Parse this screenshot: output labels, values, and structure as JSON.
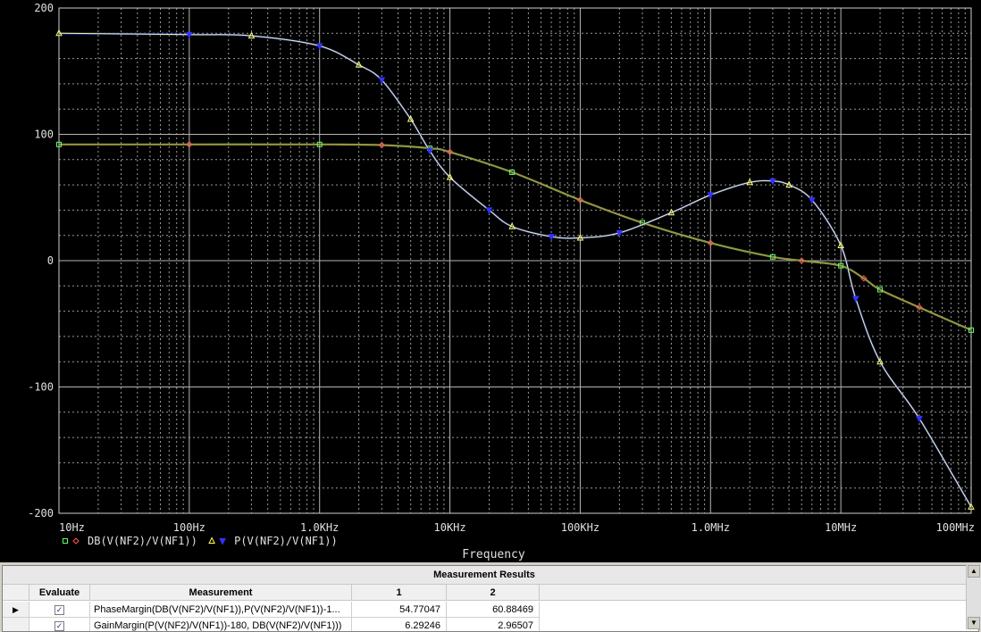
{
  "chart_data": {
    "type": "line",
    "xscale": "log",
    "xlim": [
      10,
      100000000
    ],
    "ylim": [
      -200,
      200
    ],
    "xticks": [
      {
        "label": "10Hz",
        "value": 10
      },
      {
        "label": "100Hz",
        "value": 100
      },
      {
        "label": "1.0KHz",
        "value": 1000
      },
      {
        "label": "10KHz",
        "value": 10000
      },
      {
        "label": "100KHz",
        "value": 100000
      },
      {
        "label": "1.0MHz",
        "value": 1000000
      },
      {
        "label": "10MHz",
        "value": 10000000
      },
      {
        "label": "100MHz",
        "value": 100000000
      }
    ],
    "yticks": [
      {
        "label": "200",
        "value": 200
      },
      {
        "label": "100",
        "value": 100
      },
      {
        "label": "0",
        "value": 0
      },
      {
        "label": "-100",
        "value": -100
      },
      {
        "label": "-200",
        "value": -200
      }
    ],
    "xlabel": "Frequency",
    "grid": true,
    "series": [
      {
        "name": "DB(V(NF2)/V(NF1))",
        "colors": [
          "#ff5a5a",
          "#2ecc2e"
        ],
        "markers": [
          [
            "square",
            "#66ff66"
          ],
          [
            "diamond",
            "#ff5a5a"
          ]
        ],
        "x": [
          10,
          100,
          1000,
          3000,
          7000,
          10000,
          30000,
          100000,
          300000,
          1000000,
          3000000,
          5000000,
          10000000,
          15000000,
          20000000,
          40000000,
          100000000
        ],
        "y": [
          92,
          92,
          92,
          91.5,
          89,
          86,
          70,
          48,
          30,
          14,
          3,
          0,
          -4,
          -14,
          -23,
          -37,
          -55
        ]
      },
      {
        "name": "P(V(NF2)/V(NF1))",
        "colors": [
          "#ffff66",
          "#2233dd"
        ],
        "markers": [
          [
            "triangle",
            "#ffff66"
          ],
          [
            "triangle-down",
            "#3333ff"
          ]
        ],
        "x": [
          10,
          100,
          300,
          1000,
          2000,
          3000,
          5000,
          7000,
          10000,
          20000,
          30000,
          60000,
          100000,
          200000,
          500000,
          1000000,
          2000000,
          3000000,
          4000000,
          6000000,
          10000000,
          13000000,
          20000000,
          40000000,
          100000000
        ],
        "y": [
          180,
          179,
          178,
          170,
          155,
          143,
          112,
          87,
          66,
          40,
          27,
          19,
          18,
          22,
          38,
          52,
          62,
          63,
          60,
          48,
          12,
          -30,
          -80,
          -125,
          -195
        ]
      }
    ]
  },
  "results": {
    "title": "Measurement Results",
    "headers": {
      "evaluate": "Evaluate",
      "measurement": "Measurement",
      "col1": "1",
      "col2": "2"
    },
    "rows": [
      {
        "selector": "▶",
        "checked": "✓",
        "measurement": "PhaseMargin(DB(V(NF2)/V(NF1)),P(V(NF2)/V(NF1))-1...",
        "v1": "54.77047",
        "v2": "60.88469"
      },
      {
        "selector": "",
        "checked": "✓",
        "measurement": "GainMargin(P(V(NF2)/V(NF1))-180, DB(V(NF2)/V(NF1)))",
        "v1": "6.29246",
        "v2": "2.96507"
      }
    ]
  }
}
